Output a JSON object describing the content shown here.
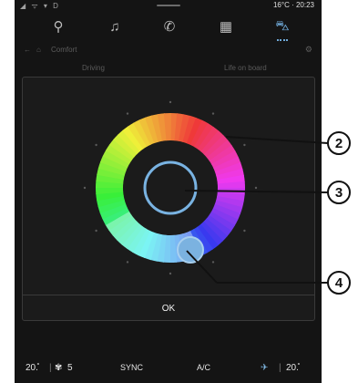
{
  "status_bar": {
    "left_icons": "◢ ᯤ ▾ D",
    "temperature": "16°C",
    "time": "20:23"
  },
  "nav": {
    "items": [
      {
        "icon": "map-pin-icon",
        "glyph": "⚲"
      },
      {
        "icon": "music-note-icon",
        "glyph": "♫"
      },
      {
        "icon": "phone-icon",
        "glyph": "✆"
      },
      {
        "icon": "apps-grid-icon",
        "glyph": "▦"
      },
      {
        "icon": "car-icon",
        "glyph": "⛍"
      }
    ]
  },
  "page": {
    "back_glyph": "←",
    "home_glyph": "⌂",
    "title": "Comfort",
    "settings_glyph": "⚙",
    "tabs": [
      "Driving",
      "Life on board"
    ]
  },
  "modal": {
    "ok_label": "OK"
  },
  "climate": {
    "temp_left": "20.̊",
    "separator": "|",
    "fan_glyph": "✾",
    "fan_speed": "5",
    "sync_label": "SYNC",
    "ac_label": "A/C",
    "seat_glyph": "✈",
    "temp_right": "20.̊"
  },
  "callouts": {
    "c2": "2",
    "c3": "3",
    "c4": "4"
  },
  "colors": {
    "accent": "#6fa9d8",
    "background": "#141414",
    "modal": "#1b1b1b"
  }
}
